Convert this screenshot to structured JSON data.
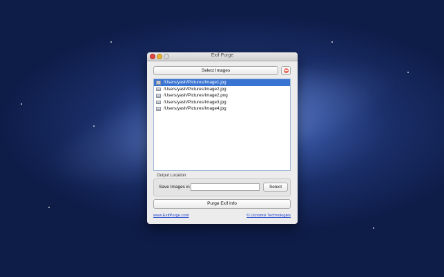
{
  "window": {
    "title": "Exif Purge"
  },
  "toolbar": {
    "select_images_label": "Select Images",
    "remove_icon": "remove-icon"
  },
  "files": [
    {
      "path": "/Users/yash/Pictures/Image1.jpg",
      "selected": true
    },
    {
      "path": "/Users/yash/Pictures/Image2.jpg",
      "selected": false
    },
    {
      "path": "/Users/yash/Pictures/Image2.png",
      "selected": false
    },
    {
      "path": "/Users/yash/Pictures/Image3.jpg",
      "selected": false
    },
    {
      "path": "/Users/yash/Pictures/Image4.jpg",
      "selected": false
    }
  ],
  "output": {
    "legend": "Output Location",
    "save_label": "Save Images in",
    "path_value": "",
    "select_label": "Select"
  },
  "actions": {
    "purge_label": "Purge Exif Info"
  },
  "footer": {
    "site_link": "www.ExifPurge.com",
    "company_link": "© Ucnomix Technologies"
  },
  "colors": {
    "selection": "#3a74d3",
    "link": "#1a3fcc"
  }
}
